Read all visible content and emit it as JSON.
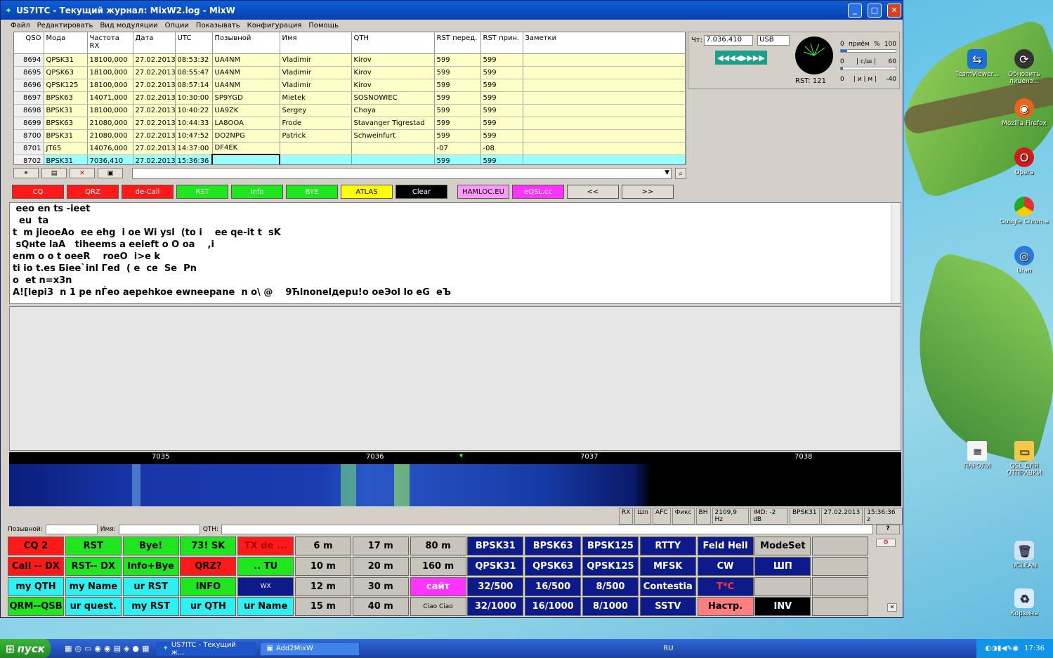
{
  "window": {
    "title": "US7ITC - Текущий журнал: MixW2.log - MixW"
  },
  "menu": [
    "Файл",
    "Редактировать",
    "Вид модуляции",
    "Опции",
    "Показывать",
    "Конфигурация",
    "Помощь"
  ],
  "log": {
    "headers": [
      "QSO",
      "Мода",
      "Частота RX",
      "Дата",
      "UTC",
      "Позывной",
      "Имя",
      "QTH",
      "RST перед.",
      "RST прин.",
      "Заметки"
    ],
    "rows": [
      [
        "8694",
        "QPSK31",
        "18100,000",
        "27.02.2013",
        "08:53:32",
        "UA4NM",
        "Vladimir",
        "Kirov",
        "599",
        "599",
        ""
      ],
      [
        "8695",
        "QPSK63",
        "18100,000",
        "27.02.2013",
        "08:55:47",
        "UA4NM",
        "Vladimir",
        "Kirov",
        "599",
        "599",
        ""
      ],
      [
        "8696",
        "QPSK125",
        "18100,000",
        "27.02.2013",
        "08:57:14",
        "UA4NM",
        "Vladimir",
        "Kirov",
        "599",
        "599",
        ""
      ],
      [
        "8697",
        "BPSK63",
        "14071,000",
        "27.02.2013",
        "10:30:00",
        "SP9YGD",
        "Mietek",
        "SOSNOWIEC",
        "599",
        "599",
        ""
      ],
      [
        "8698",
        "BPSK31",
        "18100,000",
        "27.02.2013",
        "10:40:22",
        "UA9ZK",
        "Sergey",
        "Choya",
        "599",
        "599",
        ""
      ],
      [
        "8699",
        "BPSK63",
        "21080,000",
        "27.02.2013",
        "10:44:33",
        "LA8OOA",
        "Frode",
        "Stavanger Tigrestad",
        "599",
        "599",
        ""
      ],
      [
        "8700",
        "BPSK31",
        "21080,000",
        "27.02.2013",
        "10:47:52",
        "DO2NPG",
        "Patrick",
        "Schweinfurt",
        "599",
        "599",
        ""
      ],
      [
        "8701",
        "JT65",
        "14076,000",
        "27.02.2013",
        "14:37:00",
        "DF4EK",
        "",
        "",
        "-07",
        "-08",
        ""
      ],
      [
        "8702",
        "BPSK31",
        "7036,410",
        "27.02.2013",
        "15:36:36",
        "",
        "",
        "",
        "599",
        "599",
        ""
      ]
    ]
  },
  "rig": {
    "label": "Чт:",
    "freq": "7.036.410",
    "mode": "USB",
    "arrows": "◀◀◀◀▶▶▶▶",
    "rst": "RST: 121",
    "meter": [
      {
        "a": "0",
        "b": "приём",
        "c": "%",
        "d": "100"
      },
      {
        "a": "0",
        "b": "| c/ш |",
        "c": "",
        "d": "60"
      },
      {
        "a": "0",
        "b": "| и | м |",
        "c": "",
        "d": "-40"
      }
    ]
  },
  "macros": [
    {
      "label": "CQ",
      "bg": "#ff1a1a",
      "fg": "#fff"
    },
    {
      "label": "QRZ",
      "bg": "#ff1a1a",
      "fg": "#fff"
    },
    {
      "label": "de-Call",
      "bg": "#ff1a1a",
      "fg": "#fff"
    },
    {
      "label": "RST",
      "bg": "#1fe61f",
      "fg": "#fff"
    },
    {
      "label": "Info",
      "bg": "#1fe61f",
      "fg": "#fff"
    },
    {
      "label": "BYE",
      "bg": "#1fe61f",
      "fg": "#fff"
    },
    {
      "label": "ATLAS",
      "bg": "#ffff00",
      "fg": "#000"
    },
    {
      "label": "Clear",
      "bg": "#000",
      "fg": "#fff"
    },
    {
      "label": "HAMLOC.EU",
      "bg": "#ff99ff",
      "fg": "#000"
    },
    {
      "label": "eQSL.cc",
      "bg": "#ff33ff",
      "fg": "#fff"
    },
    {
      "label": "<<",
      "bg": "#e0dcd4",
      "fg": "#000"
    },
    {
      "label": ">>",
      "bg": "#e0dcd4",
      "fg": "#000"
    }
  ],
  "rx_lines": [
    " eeo en ts -ieet",
    "  eu  ta",
    "t  m jieoeAo  ee ehg  i oe Wi ysl  (to i    ee qe-it t  sK",
    " sQнte laA   tiheems a eeieft o O oa    ,i",
    "enm o o t oeeR    roeO  i>e k",
    "ti io t.es Бiee`inl Гed  ( e  ce  Se  Pn",
    "o  et n=x3n",
    "A![lepi3  n 1 pe nЃeo aepehkoe ewneepane  n o\\ @    9Ћlnonelдepu!o oeЭol lo eG  eЪ"
  ],
  "scale": [
    "7035",
    "7036",
    "7037",
    "7038"
  ],
  "status": [
    "RX",
    "Шп",
    "AFC",
    "Фикс",
    "ВН",
    "2109,9 Hz",
    "IMD: -2 dB",
    "BPSK31",
    "27.02.2013",
    "15:36:36 z"
  ],
  "qso_fields": {
    "call": "Позывной:",
    "name": "Имя:",
    "qth": "QTH:",
    "help": "?"
  },
  "buttons": [
    [
      "CQ 2",
      "RST",
      "Bye!",
      "73! SK",
      "TX de ...",
      "6 m",
      "17 m",
      "80 m",
      "BPSK31",
      "BPSK63",
      "BPSK125",
      "RTTY",
      "Feld Hell",
      "ModeSet",
      ""
    ],
    [
      "Call -- DX",
      "RST-- DX",
      "Info+Bye",
      "QRZ?",
      ".. TU",
      "10 m",
      "20 m",
      "160 m",
      "QPSK31",
      "QPSK63",
      "QPSK125",
      "MFSK",
      "CW",
      "ШП",
      ""
    ],
    [
      "my QTH",
      "my Name",
      "ur RST",
      "INFO",
      "WX",
      "12 m",
      "30 m",
      "сайт",
      "32/500",
      "16/500",
      "8/500",
      "Contestia",
      "T*C",
      "",
      ""
    ],
    [
      "QRM--QSB",
      "ur quest.",
      "my RST",
      "ur QTH",
      "ur Name",
      "15 m",
      "40 m",
      "Ciao Ciao",
      "32/1000",
      "16/1000",
      "8/1000",
      "SSTV",
      "Настр.",
      "INV",
      ""
    ]
  ],
  "taskbar": {
    "start": "пуск",
    "tasks": [
      "US7ITC - Текущий ж...",
      "Add2MixW"
    ],
    "lang": "RU",
    "clock": "17:36"
  },
  "desktop": [
    {
      "label": "TeamViewer...",
      "icon": "teamviewer-icon"
    },
    {
      "label": "Обновить лиценз...",
      "icon": "update-license-icon"
    },
    {
      "label": "Mozilla Firefox",
      "icon": "firefox-icon"
    },
    {
      "label": "Opera",
      "icon": "opera-icon"
    },
    {
      "label": "Google Chrome",
      "icon": "chrome-icon"
    },
    {
      "label": "Uran",
      "icon": "uran-icon"
    },
    {
      "label": "ПАРОЛИ",
      "icon": "document-icon"
    },
    {
      "label": "QSL ДЛЯ ОТПРАВКИ",
      "icon": "folder-icon"
    },
    {
      "label": "UCLEAN",
      "icon": "recycle-icon"
    },
    {
      "label": "Корзина",
      "icon": "recycle-bin-icon"
    }
  ]
}
